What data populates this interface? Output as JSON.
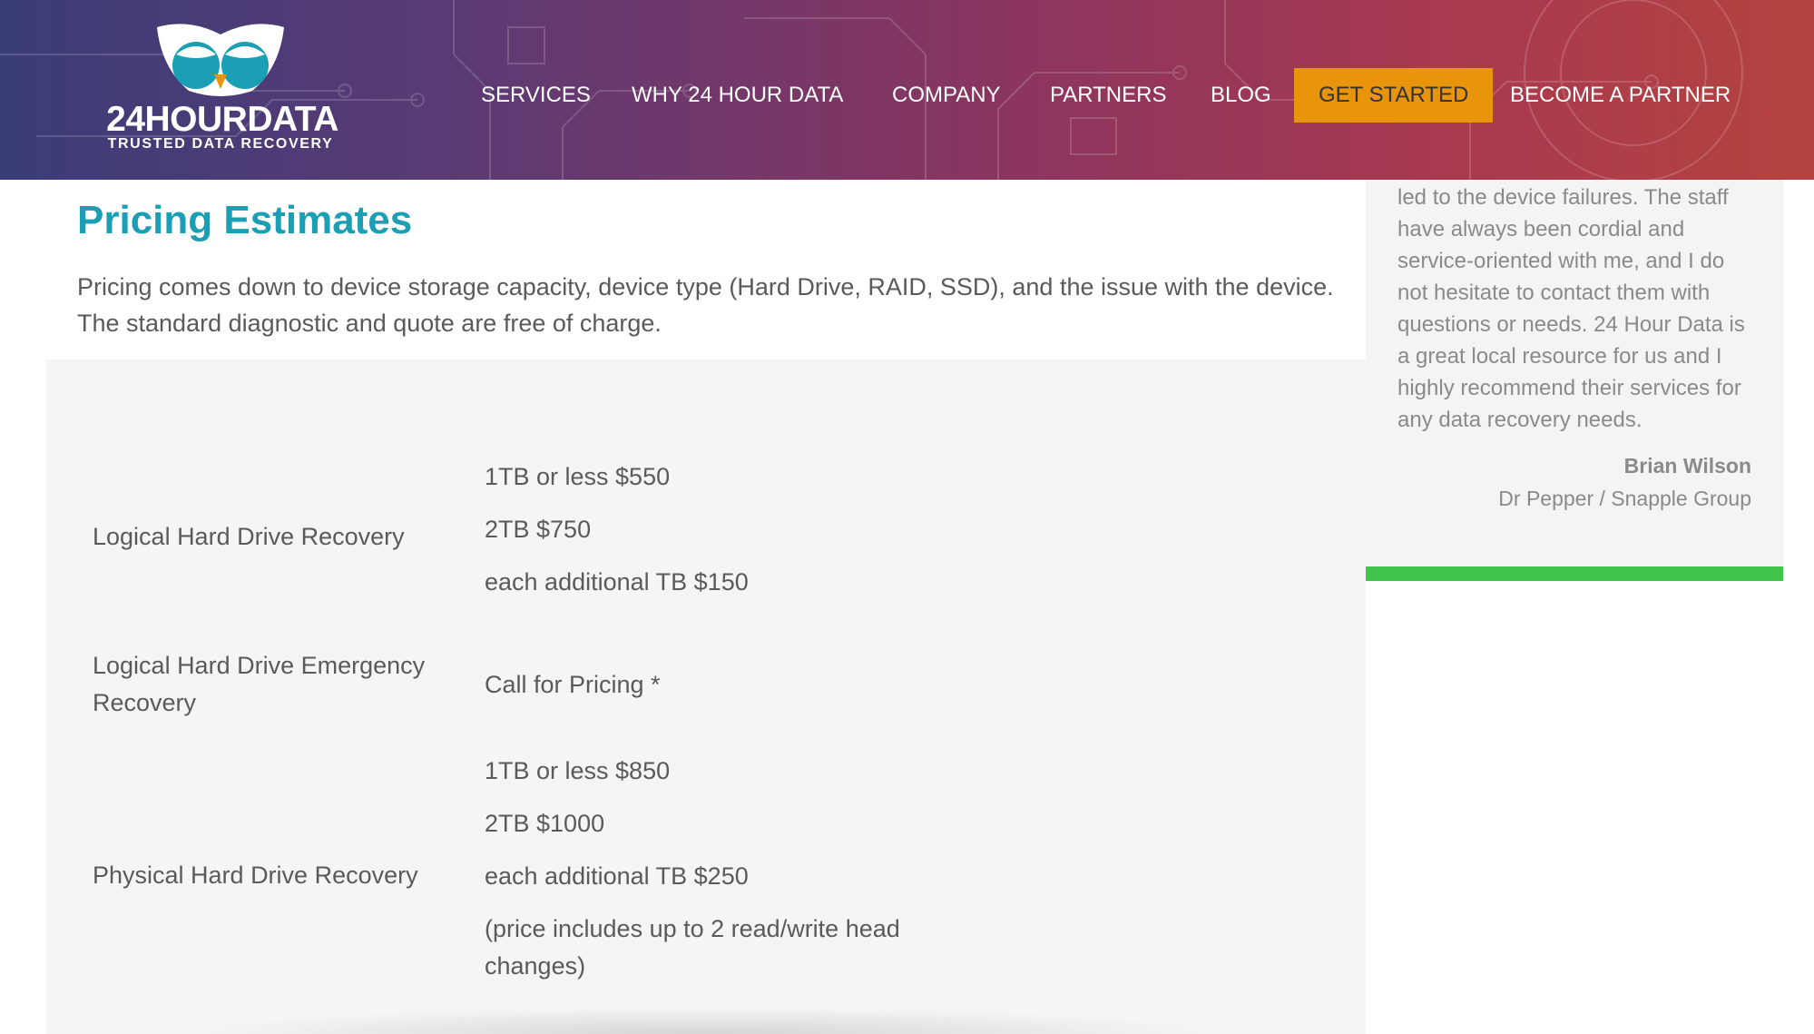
{
  "colors": {
    "accent_title": "#1a9fb4",
    "cta": "#e8950c",
    "green_bar": "#3fc44c",
    "panel_bg": "#f5f5f5"
  },
  "brand": {
    "logo_text": "24HOURDATA",
    "logo_subtitle": "TRUSTED DATA RECOVERY",
    "logo_icon": "owl-icon"
  },
  "nav": {
    "items": [
      {
        "label": "SERVICES"
      },
      {
        "label": "WHY 24 HOUR DATA"
      },
      {
        "label": "COMPANY"
      },
      {
        "label": "PARTNERS"
      },
      {
        "label": "BLOG"
      },
      {
        "label": "GET STARTED"
      },
      {
        "label": "BECOME A PARTNER"
      }
    ]
  },
  "main": {
    "title": "Pricing Estimates",
    "intro": "Pricing comes down to device storage capacity, device type (Hard Drive, RAID, SSD), and the issue with the device. The standard diagnostic and quote are free of charge.",
    "services": [
      {
        "name": "Logical Hard Drive Recovery",
        "prices": [
          "1TB or less $550",
          "2TB $750",
          "each additional TB $150"
        ]
      },
      {
        "name": "Logical Hard Drive Emergency Recovery",
        "prices": [
          "Call for Pricing *"
        ]
      },
      {
        "name": "Physical Hard Drive Recovery",
        "prices": [
          "1TB or less $850",
          "2TB $1000",
          "each additional TB $250",
          "(price includes up to 2 read/write head changes)"
        ]
      }
    ]
  },
  "sidebar": {
    "testimonial": "led to the device failures. The staff have always been cordial and service-oriented with me, and I do not hesitate to contact them with questions or needs. 24 Hour Data is a great local resource for us and I highly recommend their services for any data recovery needs.",
    "author": "Brian Wilson",
    "company": "Dr Pepper / Snapple Group"
  }
}
